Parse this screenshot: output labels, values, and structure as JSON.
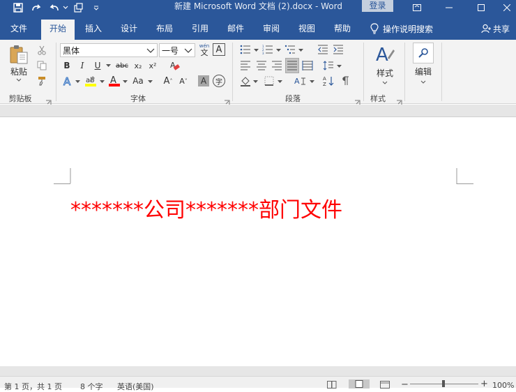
{
  "title_bar": {
    "title": "新建 Microsoft Word 文档 (2).docx  -  Word",
    "login_label": "登录"
  },
  "tabs": [
    {
      "label": "文件"
    },
    {
      "label": "开始"
    },
    {
      "label": "插入"
    },
    {
      "label": "设计"
    },
    {
      "label": "布局"
    },
    {
      "label": "引用"
    },
    {
      "label": "邮件"
    },
    {
      "label": "审阅"
    },
    {
      "label": "视图"
    },
    {
      "label": "帮助"
    }
  ],
  "tell_me_label": "操作说明搜索",
  "share_label": "共享",
  "ribbon": {
    "clipboard": {
      "paste_label": "粘贴",
      "group_label": "剪贴板"
    },
    "font": {
      "font_name": "黑体",
      "font_size": "一号",
      "wen_label": "wén",
      "wen_char": "文",
      "bold": "B",
      "italic": "I",
      "underline": "U",
      "strike": "abc",
      "sub": "x₂",
      "sup": "x²",
      "change_case": "Aa",
      "grow": "A",
      "shrink": "A",
      "char_shading": "A",
      "enclose": "字",
      "highlight_color": "#ffff00",
      "font_color": "#ff0000",
      "group_label": "字体"
    },
    "paragraph": {
      "group_label": "段落"
    },
    "styles": {
      "label": "样式",
      "group_label": "样式"
    },
    "editing": {
      "label": "编辑"
    }
  },
  "document": {
    "text": "*******公司*******部门文件",
    "text_color": "#ff0000"
  },
  "status_bar": {
    "page": "第 1 页，共 1 页",
    "words": "8 个字",
    "language": "英语(美国)",
    "zoom": "100%"
  }
}
